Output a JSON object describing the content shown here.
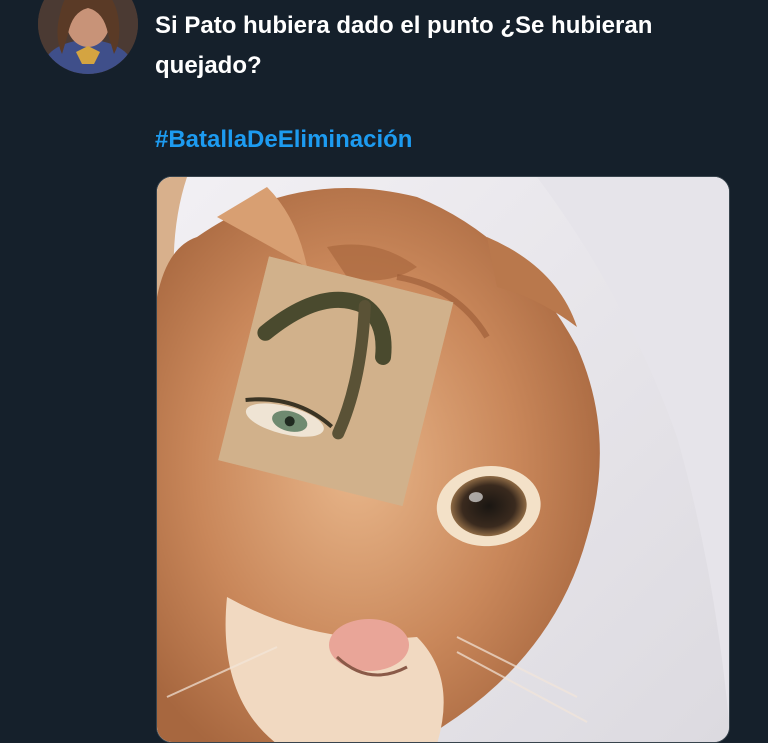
{
  "tweet": {
    "text": "Si Pato hubiera dado el punto ¿Se hubieran quejado?",
    "hashtag": "#BatallaDeEliminación",
    "avatar": {
      "icon": "user-avatar"
    },
    "media": {
      "icon": "cat-meme-image"
    }
  },
  "colors": {
    "background": "#15202b",
    "text": "#ffffff",
    "link": "#1d9bf0",
    "media_border": "#38444d"
  }
}
